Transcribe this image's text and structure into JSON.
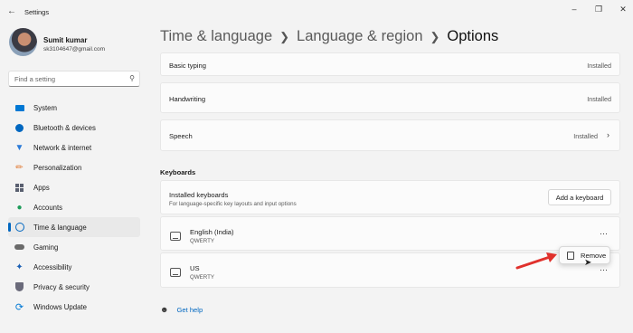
{
  "app": {
    "title": "Settings"
  },
  "user": {
    "name": "Sumit kumar",
    "email": "sk3104647@gmail.com"
  },
  "search": {
    "placeholder": "Find a setting"
  },
  "nav": [
    {
      "label": "System",
      "icon": "monitor-icon",
      "color": "#0078d4"
    },
    {
      "label": "Bluetooth & devices",
      "icon": "bluetooth-icon",
      "color": "#0067c0"
    },
    {
      "label": "Network & internet",
      "icon": "wifi-icon",
      "color": "#2a7ad8"
    },
    {
      "label": "Personalization",
      "icon": "brush-icon",
      "color": "#e0742a"
    },
    {
      "label": "Apps",
      "icon": "apps-icon",
      "color": "#5a6070"
    },
    {
      "label": "Accounts",
      "icon": "person-icon",
      "color": "#1e9c5a"
    },
    {
      "label": "Time & language",
      "icon": "globe-clock-icon",
      "color": "#0067c0",
      "active": true
    },
    {
      "label": "Gaming",
      "icon": "gamepad-icon",
      "color": "#6a6a6a"
    },
    {
      "label": "Accessibility",
      "icon": "accessibility-icon",
      "color": "#1a5fb4"
    },
    {
      "label": "Privacy & security",
      "icon": "shield-icon",
      "color": "#6a6a7a"
    },
    {
      "label": "Windows Update",
      "icon": "refresh-icon",
      "color": "#0078d4"
    }
  ],
  "breadcrumb": {
    "part1": "Time & language",
    "part2": "Language & region",
    "current": "Options"
  },
  "features": [
    {
      "label": "Basic typing",
      "status": "Installed"
    },
    {
      "label": "Handwriting",
      "status": "Installed"
    },
    {
      "label": "Speech",
      "status": "Installed"
    }
  ],
  "keyboards": {
    "section_title": "Keyboards",
    "installed_title": "Installed keyboards",
    "installed_desc": "For language-specific key layouts and input options",
    "add_button": "Add a keyboard",
    "items": [
      {
        "name": "English (India)",
        "layout": "QWERTY"
      },
      {
        "name": "US",
        "layout": "QWERTY"
      }
    ]
  },
  "context_menu": {
    "remove_label": "Remove"
  },
  "help": {
    "label": "Get help"
  },
  "colors": {
    "accent": "#0067c0",
    "annotation_arrow": "#e0312c"
  }
}
